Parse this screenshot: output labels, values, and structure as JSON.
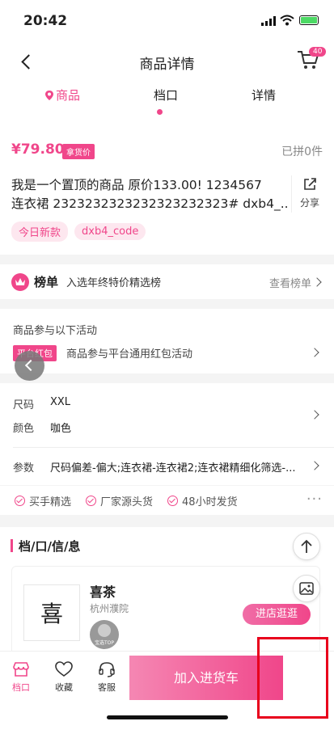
{
  "status": {
    "time": "20:42"
  },
  "nav": {
    "title": "商品详情",
    "cart_count": "40"
  },
  "tabs": [
    {
      "label": "商品"
    },
    {
      "label": "档口"
    },
    {
      "label": "详情"
    }
  ],
  "price": {
    "value": "¥79.80",
    "badge": "拿货价",
    "sold": "已拼0件"
  },
  "product": {
    "title_line1": "我是一个置顶的商品 原价133.00! 1234567",
    "title_line2": "连衣裙 2323232323232323232323# dxb4_...",
    "share_label": "分享",
    "tags": [
      "今日新款",
      "dxb4_code"
    ]
  },
  "ranking": {
    "label": "榜单",
    "desc": "入选年终特价精选榜",
    "link": "查看榜单"
  },
  "activity": {
    "title": "商品参与以下活动",
    "badge": "平台红包",
    "desc": "商品参与平台通用红包活动"
  },
  "specs": {
    "size_label": "尺码",
    "size_value": "XXL",
    "color_label": "颜色",
    "color_value": "咖色",
    "param_label": "参数",
    "param_value": "尺码偏差-偏大;连衣裙-连衣裙2;连衣裙精细化筛选-..."
  },
  "guarantees": [
    "买手精选",
    "厂家源头货",
    "48小时发货"
  ],
  "shop": {
    "section_title": "档/口/信/息",
    "logo_char": "喜",
    "name": "喜茶",
    "location": "杭州濮院",
    "enter_label": "进店逛逛",
    "badge_text": "宝选TOP"
  },
  "bottom": {
    "items": [
      {
        "label": "档口"
      },
      {
        "label": "收藏"
      },
      {
        "label": "客服"
      }
    ],
    "add_cart": "加入进货车"
  },
  "colors": {
    "accent": "#f0468a",
    "annotation": "#e8001c"
  }
}
